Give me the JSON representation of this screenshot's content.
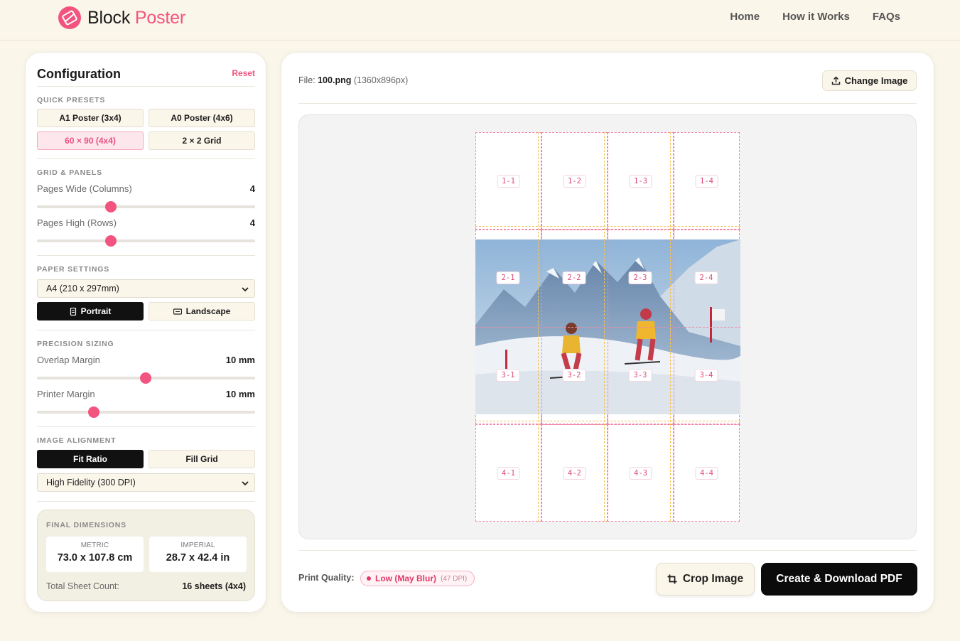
{
  "brand": {
    "name_part1": "Block",
    "name_part2": "Poster",
    "accent": "#f2547f"
  },
  "nav": {
    "items": [
      "Home",
      "How it Works",
      "FAQs"
    ]
  },
  "config": {
    "title": "Configuration",
    "reset_label": "Reset",
    "presets": {
      "label": "QUICK PRESETS",
      "items": [
        "A1 Poster (3x4)",
        "A0 Poster (4x6)",
        "60 × 90 (4x4)",
        "2 × 2 Grid"
      ],
      "selected": "60 × 90 (4x4)"
    },
    "grid": {
      "label": "GRID & PANELS",
      "columns_label": "Pages Wide (Columns)",
      "columns_value": "4",
      "rows_label": "Pages High (Rows)",
      "rows_value": "4"
    },
    "paper": {
      "label": "PAPER SETTINGS",
      "size_value": "A4 (210 x 297mm)",
      "portrait_label": "Portrait",
      "landscape_label": "Landscape",
      "orientation": "Portrait"
    },
    "precision": {
      "label": "PRECISION SIZING",
      "overlap_label": "Overlap Margin",
      "overlap_value": "10 mm",
      "printer_label": "Printer Margin",
      "printer_value": "10 mm"
    },
    "alignment": {
      "label": "IMAGE ALIGNMENT",
      "fit_label": "Fit Ratio",
      "fill_label": "Fill Grid",
      "selected": "Fit Ratio",
      "quality_value": "High Fidelity (300 DPI)"
    },
    "final": {
      "label": "FINAL DIMENSIONS",
      "metric_label": "METRIC",
      "metric_value": "73.0 x 107.8 cm",
      "imperial_label": "IMPERIAL",
      "imperial_value": "28.7 x 42.4 in",
      "sheet_label": "Total Sheet Count:",
      "sheet_value": "16 sheets (4x4)"
    }
  },
  "preview": {
    "file_prefix": "File:",
    "file_name": "100.png",
    "file_dims": "(1360x896px)",
    "change_label": "Change Image",
    "tiles": [
      "1-1",
      "1-2",
      "1-3",
      "1-4",
      "2-1",
      "2-2",
      "2-3",
      "2-4",
      "3-1",
      "3-2",
      "3-3",
      "3-4",
      "4-1",
      "4-2",
      "4-3",
      "4-4"
    ],
    "print_quality_label": "Print Quality:",
    "print_quality_value": "Low (May Blur)",
    "print_quality_dpi": "(47 DPI)",
    "crop_label": "Crop Image",
    "download_label": "Create & Download PDF"
  }
}
